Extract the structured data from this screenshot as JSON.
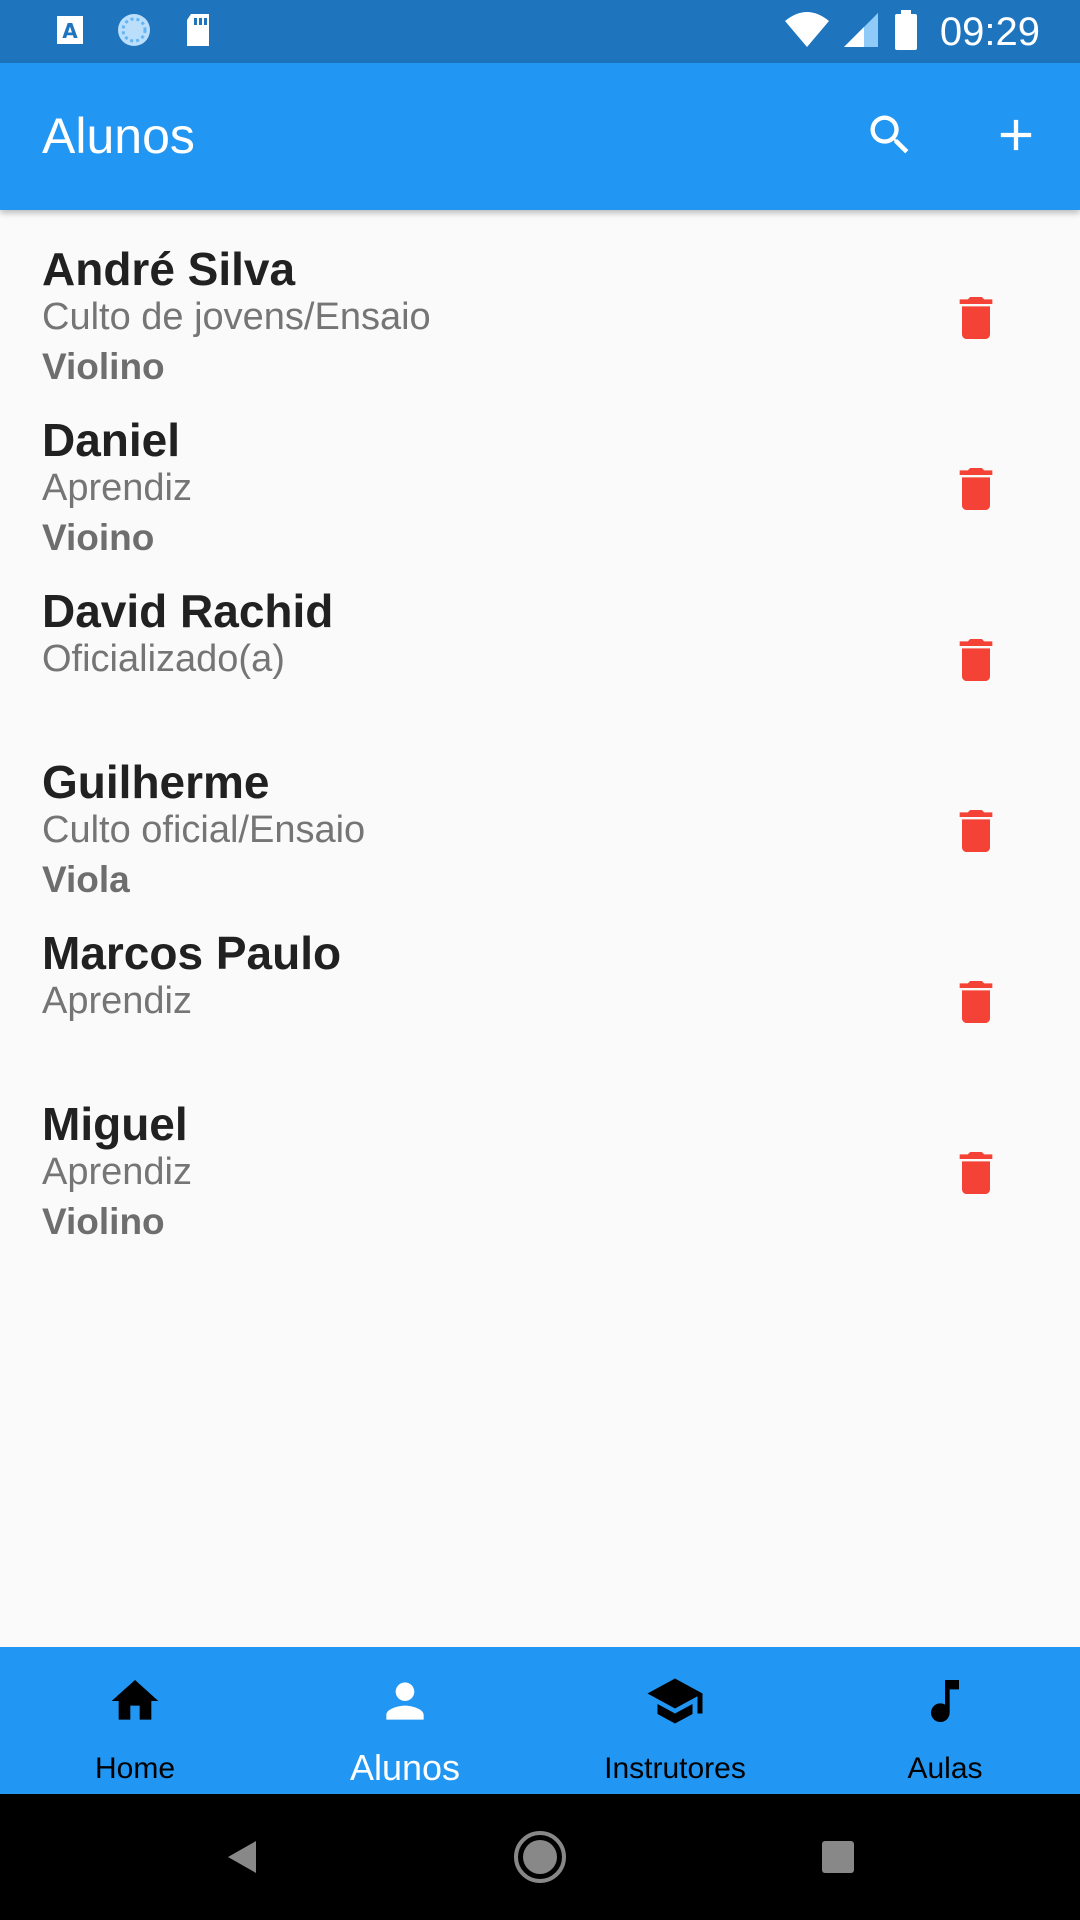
{
  "status_bar": {
    "time": "09:29",
    "icons": [
      "app-a-icon",
      "sync-icon",
      "sd-card-icon",
      "wifi-icon",
      "signal-icon",
      "battery-icon"
    ]
  },
  "app_bar": {
    "title": "Alunos",
    "actions": [
      "search-icon",
      "add-icon"
    ]
  },
  "students": [
    {
      "name": "André Silva",
      "subtitle": "Culto de jovens/Ensaio",
      "instrument": "Violino"
    },
    {
      "name": "Daniel",
      "subtitle": "Aprendiz",
      "instrument": "Vioino"
    },
    {
      "name": "David Rachid",
      "subtitle": "Oficializado(a)",
      "instrument": ""
    },
    {
      "name": "Guilherme",
      "subtitle": "Culto oficial/Ensaio",
      "instrument": "Viola"
    },
    {
      "name": "Marcos Paulo",
      "subtitle": "Aprendiz",
      "instrument": ""
    },
    {
      "name": "Miguel",
      "subtitle": "Aprendiz",
      "instrument": "Violino"
    }
  ],
  "bottom_nav": [
    {
      "label": "Home",
      "icon": "home-icon",
      "active": false
    },
    {
      "label": "Alunos",
      "icon": "person-icon",
      "active": true
    },
    {
      "label": "Instrutores",
      "icon": "graduation-cap-icon",
      "active": false
    },
    {
      "label": "Aulas",
      "icon": "music-note-icon",
      "active": false
    }
  ],
  "colors": {
    "status_bar": "#1E74BD",
    "primary": "#2196F3",
    "delete": "#F44336",
    "background": "#FAFAFA"
  }
}
